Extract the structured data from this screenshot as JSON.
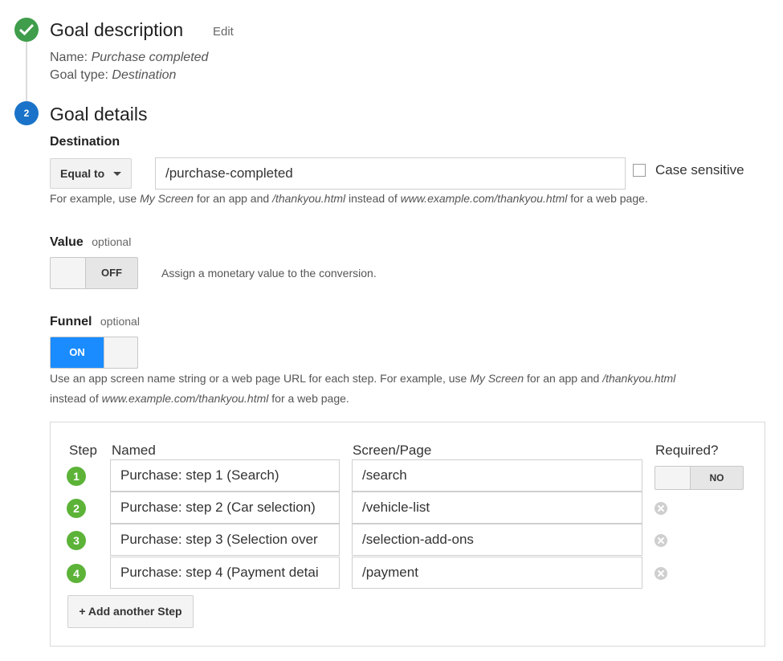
{
  "goal_description": {
    "title": "Goal description",
    "edit_label": "Edit",
    "name_label": "Name:",
    "name_value": "Purchase completed",
    "type_label": "Goal type:",
    "type_value": "Destination"
  },
  "goal_details": {
    "step_number": "2",
    "title": "Goal details"
  },
  "destination": {
    "label": "Destination",
    "match_type": "Equal to",
    "value": "/purchase-completed",
    "case_sensitive_label": "Case sensitive",
    "help": {
      "prefix": "For example, use ",
      "app_example": "My Screen",
      "mid": " for an app and ",
      "page_example": "/thankyou.html",
      "mid2": " instead of ",
      "url_example": "www.example.com/thankyou.html",
      "suffix": " for a web page."
    }
  },
  "value_section": {
    "label": "Value",
    "optional": "optional",
    "toggle_state": "OFF",
    "description": "Assign a monetary value to the conversion."
  },
  "funnel": {
    "label": "Funnel",
    "optional": "optional",
    "toggle_state": "ON",
    "help_line1": {
      "prefix": "Use an app screen name string or a web page URL for each step. For example, use ",
      "app_example": "My Screen",
      "mid": " for an app and ",
      "page_example": "/thankyou.html"
    },
    "help_line2": {
      "prefix": "instead of ",
      "url_example": "www.example.com/thankyou.html",
      "suffix": " for a web page."
    },
    "columns": {
      "step": "Step",
      "named": "Named",
      "screen": "Screen/Page",
      "required": "Required?"
    },
    "steps": [
      {
        "number": "1",
        "name": "Purchase: step 1 (Search)",
        "screen": "/search"
      },
      {
        "number": "2",
        "name": "Purchase: step 2 (Car selection)",
        "screen": "/vehicle-list"
      },
      {
        "number": "3",
        "name": "Purchase: step 3 (Selection over",
        "screen": "/selection-add-ons"
      },
      {
        "number": "4",
        "name": "Purchase: step 4 (Payment detai",
        "screen": "/payment"
      }
    ],
    "required_toggle": "NO",
    "add_step_label": "+ Add another Step"
  },
  "colors": {
    "check_green": "#3f9d4b",
    "step_blue": "#1a73c8",
    "toggle_on_blue": "#1a8cff",
    "funnel_step_green": "#5cb338"
  },
  "icons": [
    "check-icon",
    "caret-down-icon",
    "remove-step-icon"
  ]
}
